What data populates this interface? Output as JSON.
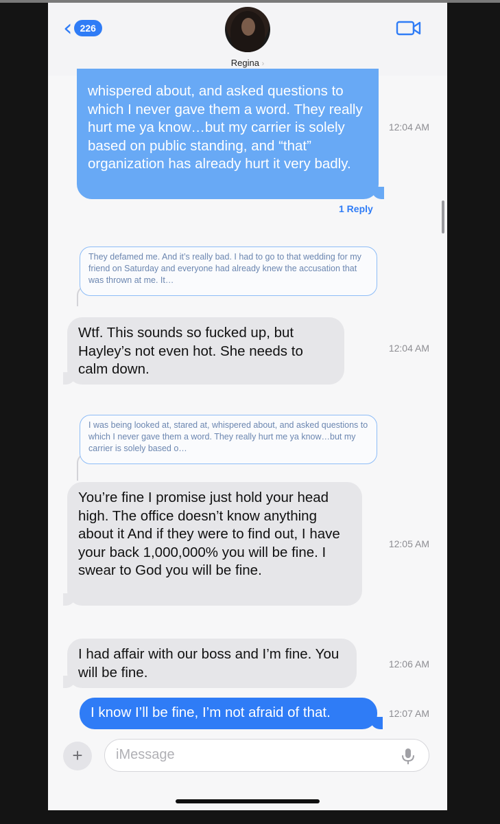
{
  "header": {
    "back_count": "226",
    "contact_name": "Regina",
    "name_chevron": "›",
    "back_icon": "chevron-left-icon",
    "video_icon": "video-camera-icon"
  },
  "messages": [
    {
      "id": "m1",
      "sender": "me",
      "text": "whispered about, and asked questions to which I never gave them a word. They really hurt me ya know…but my carrier is solely based on public standing, and “that” organization has already hurt it very badly.",
      "time": "12:04 AM",
      "reply_count": "1 Reply"
    },
    {
      "id": "q1",
      "type": "quote",
      "text": "They defamed me. And it’s really bad. I had to go to that wedding for my friend  on Saturday and everyone had already knew the accusation that was thrown at me. It…"
    },
    {
      "id": "m2",
      "sender": "them",
      "text": "Wtf. This sounds so fucked up, but Hayley’s not even hot. She needs to calm down.",
      "time": "12:04 AM"
    },
    {
      "id": "q2",
      "type": "quote",
      "text": "I was being looked at, stared at,  whispered about, and asked questions to which I never gave them a word. They really hurt me ya know…but my carrier is solely based o…"
    },
    {
      "id": "m3",
      "sender": "them",
      "text": "You’re fine I promise just hold your head high. The office doesn’t know anything about it And if they were to find out, I have your back 1,000,000% you will be fine. I swear to God you will be fine.",
      "time": "12:05 AM"
    },
    {
      "id": "m4",
      "sender": "them",
      "text": "I had affair with our boss and I’m fine. You will be fine.",
      "time": "12:06 AM"
    },
    {
      "id": "m5",
      "sender": "me",
      "text": "I know I’ll be fine, I’m not afraid of that.",
      "time": "12:07 AM"
    }
  ],
  "composer": {
    "plus_label": "+",
    "placeholder": "iMessage",
    "mic_icon": "microphone-icon"
  },
  "colors": {
    "accent": "#2f7cf6",
    "sent_faded": "#68a9f5",
    "received": "#e6e6e9"
  }
}
